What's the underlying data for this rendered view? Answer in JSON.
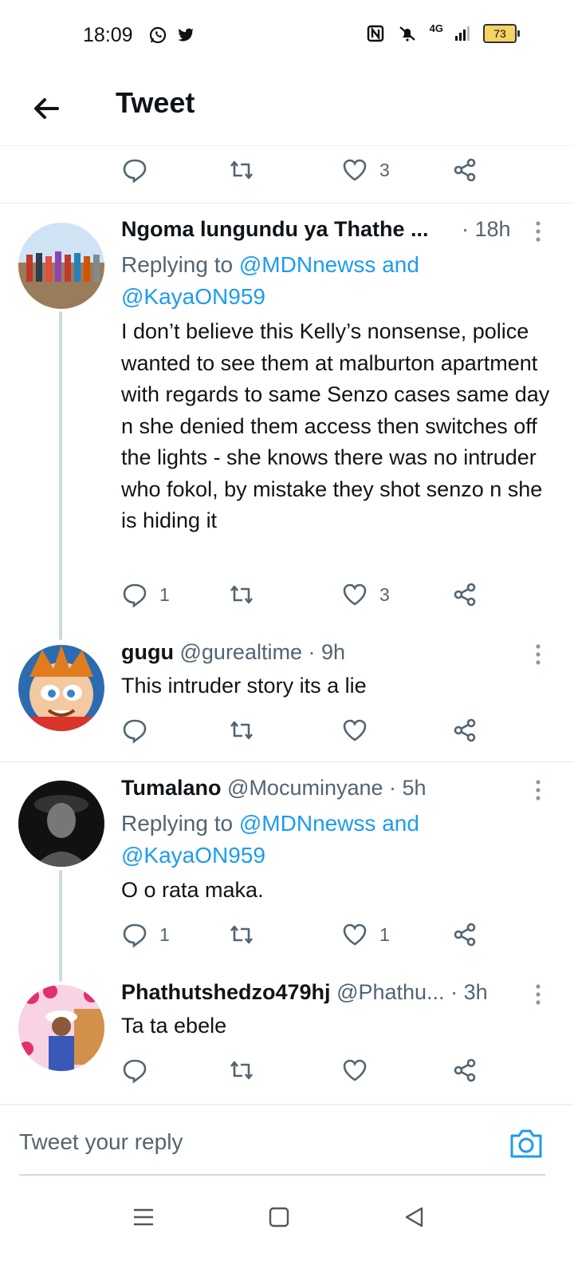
{
  "status_bar": {
    "time": "18:09",
    "battery": "73",
    "network": "4G"
  },
  "header": {
    "title": "Tweet"
  },
  "top_actions": {
    "like_count": "3"
  },
  "tweets": [
    {
      "name": "Ngoma lungundu ya Thathe ...",
      "handle": "",
      "time": "· 18h",
      "replying_prefix": "Replying to ",
      "replying_1": "@MDNnewss and",
      "replying_2": "@KayaON959",
      "text": "I don’t believe this Kelly’s nonsense, police wanted to see them at malburton apartment with regards to same Senzo cases same day n she denied them access then switches off the lights - she knows there was no intruder who fokol, by mistake they shot senzo n she is hiding it",
      "reply_count": "1",
      "like_count": "3"
    },
    {
      "name": "gugu",
      "handle": "@gurealtime",
      "time": "· 9h",
      "text": "This intruder story its a lie",
      "reply_count": "",
      "like_count": ""
    },
    {
      "name": "Tumalano",
      "handle": "@Mocuminyane",
      "time": "· 5h",
      "replying_prefix": "Replying to ",
      "replying_1": "@MDNnewss and",
      "replying_2": "@KayaON959",
      "text": "O o rata maka.",
      "reply_count": "1",
      "like_count": "1"
    },
    {
      "name": "Phathutshedzo479hj",
      "handle": "@Phathu...",
      "time": "· 3h",
      "text": "Ta ta ebele",
      "reply_count": "",
      "like_count": ""
    }
  ],
  "composer": {
    "placeholder": "Tweet your reply"
  },
  "colors": {
    "accent": "#1d9bf0",
    "text": "#0f1419",
    "secondary": "#536471"
  }
}
